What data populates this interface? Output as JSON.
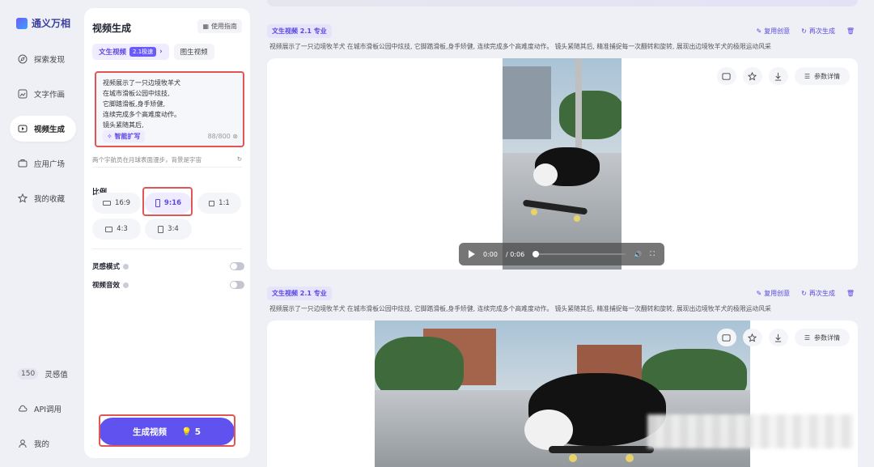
{
  "app": {
    "logo_text": "通义万相"
  },
  "nav": {
    "items": [
      {
        "label": "探索发现",
        "icon": "compass-icon"
      },
      {
        "label": "文字作画",
        "icon": "image-edit-icon"
      },
      {
        "label": "视频生成",
        "icon": "video-icon",
        "active": true
      },
      {
        "label": "应用广场",
        "icon": "apps-icon"
      },
      {
        "label": "我的收藏",
        "icon": "star-icon"
      }
    ],
    "credits": {
      "value": "150",
      "label": "灵感值"
    },
    "api_label": "API调用",
    "profile_label": "我的"
  },
  "panel": {
    "title": "视频生成",
    "guide_label": "使用指南",
    "tabs": [
      {
        "label": "文生视频",
        "badge": "2.1极速",
        "active": true
      },
      {
        "label": "图生视频"
      }
    ],
    "prompt": {
      "text": "视频展示了一只边境牧羊犬\n在城市滑板公园中炫技,\n它脚踏滑板,身手矫健,\n连续完成多个高难度动作。\n镜头紧随其后,",
      "expand_label": "智能扩写",
      "count": "88",
      "max": "/800"
    },
    "hint": "两个宇航员在月球表面漫步，背景是宇宙",
    "ratio_label": "比例",
    "ratios": [
      {
        "label": "16:9",
        "active": false
      },
      {
        "label": "9:16",
        "active": true
      },
      {
        "label": "1:1",
        "active": false
      },
      {
        "label": "4:3",
        "active": false
      },
      {
        "label": "3:4",
        "active": false
      }
    ],
    "options": [
      {
        "label": "灵感模式",
        "on": false
      },
      {
        "label": "视频音效",
        "on": false
      }
    ],
    "generate": {
      "label": "生成视频",
      "cost": "5"
    }
  },
  "results": [
    {
      "tag": "文生视频 2.1 专业",
      "actions": [
        "复用创意",
        "再次生成"
      ],
      "description": "视频展示了一只边境牧羊犬 在城市滑板公园中炫技, 它脚踏滑板,身手矫健, 连续完成多个高难度动作。 镜头紧随其后, 精准捕捉每一次翻转和旋转, 展现出边境牧羊犬的极限运动风采",
      "param_label": "参数详情",
      "player": {
        "time": "0:00",
        "duration": "/ 0:06",
        "progress": 0
      }
    },
    {
      "tag": "文生视频 2.1 专业",
      "actions": [
        "复用创意",
        "再次生成"
      ],
      "description": "视频展示了一只边境牧羊犬 在城市滑板公园中炫技, 它脚踏滑板,身手矫健, 连续完成多个高难度动作。 镜头紧随其后, 精准捕捉每一次翻转和旋转, 展现出边境牧羊犬的极限运动风采",
      "param_label": "参数详情"
    }
  ]
}
